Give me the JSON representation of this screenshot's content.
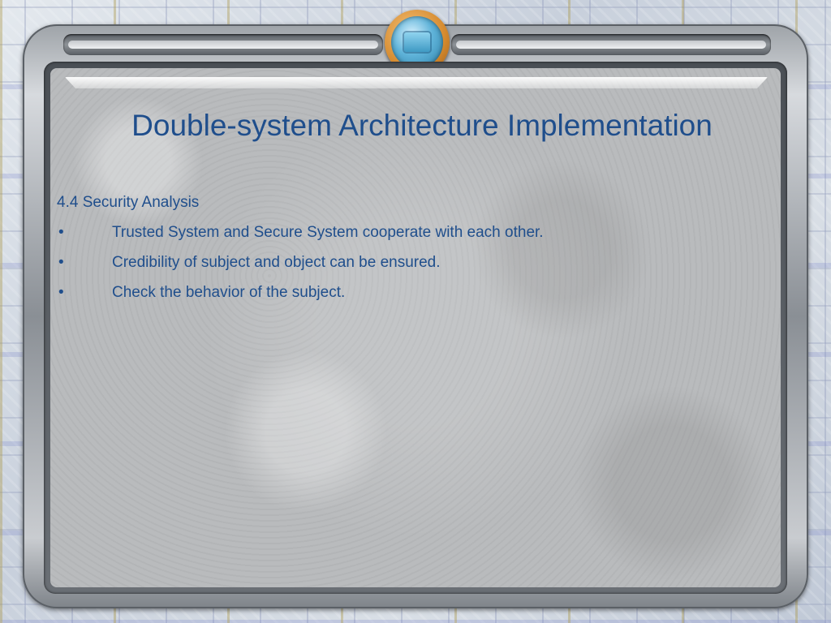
{
  "slide": {
    "title": "Double-system Architecture Implementation",
    "section_heading": "4.4 Security Analysis",
    "bullet_glyph": "•",
    "bullets": [
      "Trusted System and Secure System cooperate with each other.",
      "Credibility of subject and object can be ensured.",
      "Check the behavior of the subject."
    ]
  },
  "colors": {
    "text": "#1f4e8c",
    "panel": "#b9bbbd",
    "frame": "#8a8f95",
    "emblem_ring": "#d58a2e",
    "emblem_center": "#5fb3d9"
  },
  "icons": {
    "emblem": "circuit-chip-emblem-icon"
  }
}
